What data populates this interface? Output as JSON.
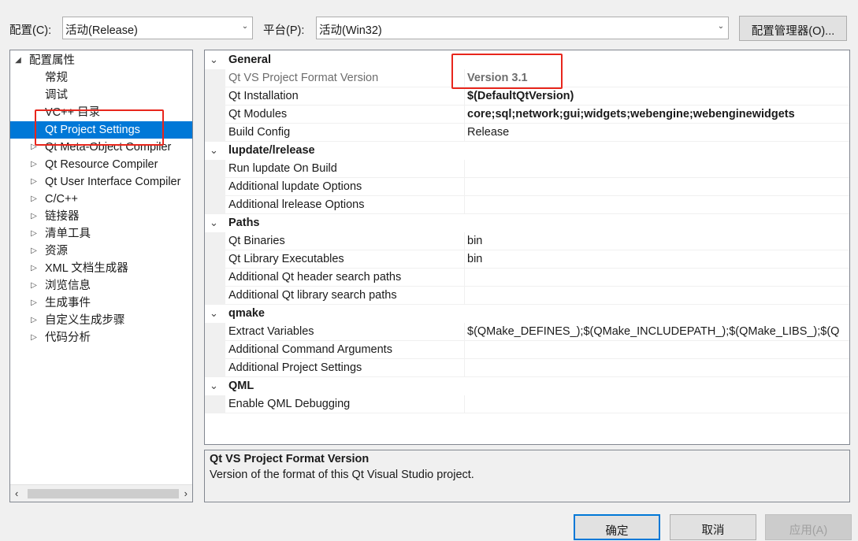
{
  "toolbar": {
    "config_label": "配置(C):",
    "config_value": "活动(Release)",
    "platform_label": "平台(P):",
    "platform_value": "活动(Win32)",
    "config_manager": "配置管理器(O)..."
  },
  "tree": {
    "root": "配置属性",
    "items": [
      {
        "label": "常规",
        "expandable": false
      },
      {
        "label": "调试",
        "expandable": false
      },
      {
        "label": "VC++ 目录",
        "expandable": false
      },
      {
        "label": "Qt Project Settings",
        "expandable": false,
        "selected": true
      },
      {
        "label": "Qt Meta-Object Compiler",
        "expandable": true
      },
      {
        "label": "Qt Resource Compiler",
        "expandable": true
      },
      {
        "label": "Qt User Interface Compiler",
        "expandable": true
      },
      {
        "label": "C/C++",
        "expandable": true
      },
      {
        "label": "链接器",
        "expandable": true
      },
      {
        "label": "清单工具",
        "expandable": true
      },
      {
        "label": "资源",
        "expandable": true
      },
      {
        "label": "XML 文档生成器",
        "expandable": true
      },
      {
        "label": "浏览信息",
        "expandable": true
      },
      {
        "label": "生成事件",
        "expandable": true
      },
      {
        "label": "自定义生成步骤",
        "expandable": true
      },
      {
        "label": "代码分析",
        "expandable": true
      }
    ]
  },
  "grid": {
    "categories": [
      {
        "name": "General",
        "props": [
          {
            "name": "Qt VS Project Format Version",
            "value": "Version 3.1",
            "bold": true,
            "dim": true
          },
          {
            "name": "Qt Installation",
            "value": "$(DefaultQtVersion)",
            "bold": true
          },
          {
            "name": "Qt Modules",
            "value": "core;sql;network;gui;widgets;webengine;webenginewidgets",
            "bold": true
          },
          {
            "name": "Build Config",
            "value": "Release"
          }
        ]
      },
      {
        "name": "lupdate/lrelease",
        "props": [
          {
            "name": "Run lupdate On Build",
            "value": ""
          },
          {
            "name": "Additional lupdate Options",
            "value": ""
          },
          {
            "name": "Additional lrelease Options",
            "value": ""
          }
        ]
      },
      {
        "name": "Paths",
        "props": [
          {
            "name": "Qt Binaries",
            "value": "bin"
          },
          {
            "name": "Qt Library Executables",
            "value": "bin"
          },
          {
            "name": "Additional Qt header search paths",
            "value": ""
          },
          {
            "name": "Additional Qt library search paths",
            "value": ""
          }
        ]
      },
      {
        "name": "qmake",
        "props": [
          {
            "name": "Extract Variables",
            "value": "$(QMake_DEFINES_);$(QMake_INCLUDEPATH_);$(QMake_LIBS_);$(Q"
          },
          {
            "name": "Additional Command Arguments",
            "value": ""
          },
          {
            "name": "Additional Project Settings",
            "value": ""
          }
        ]
      },
      {
        "name": "QML",
        "props": [
          {
            "name": "Enable QML Debugging",
            "value": ""
          }
        ]
      }
    ]
  },
  "description": {
    "title": "Qt VS Project Format Version",
    "text": "Version of the format of this Qt Visual Studio project."
  },
  "buttons": {
    "ok": "确定",
    "cancel": "取消",
    "apply": "应用(A)"
  },
  "colors": {
    "selection": "#0078d7",
    "highlight_box": "#e8261c"
  }
}
